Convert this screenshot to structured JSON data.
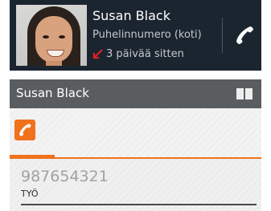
{
  "call_log": {
    "contact_name": "Susan Black",
    "number_type": "Puhelinnumero (koti)",
    "call_time": "3 päivää sitten",
    "missed_color": "#e02020",
    "call_icon": "phone-handset-icon"
  },
  "detail": {
    "title": "Susan Black",
    "contacts_icon": "book-icon",
    "tab_icon": "phone-handset-icon",
    "accent": "#f0721c",
    "phone_number": "987654321",
    "phone_label": "TYÖ"
  }
}
